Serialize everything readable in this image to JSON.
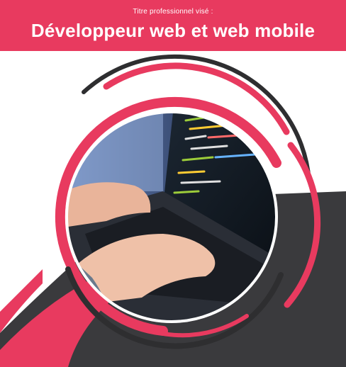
{
  "header": {
    "subtitle": "Titre professionnel visé :",
    "title": "Développeur web et web mobile"
  },
  "colors": {
    "accent": "#e83a5f",
    "dark": "#3a3a3d",
    "background": "#ffffff"
  },
  "image": {
    "description_icon": "laptop-code-photo-icon"
  }
}
